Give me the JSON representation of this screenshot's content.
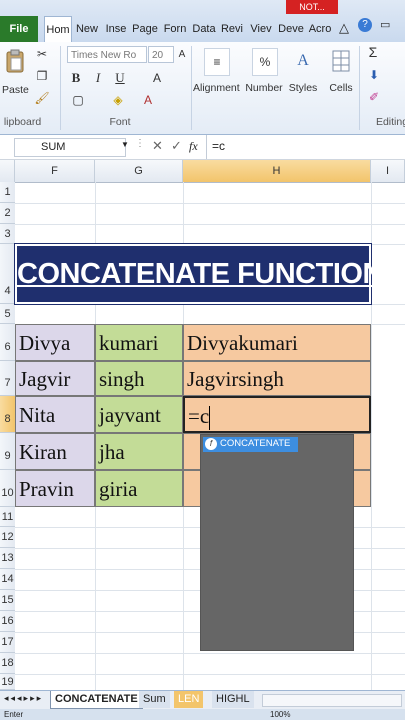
{
  "title_bar": {
    "alert_button": "NOT..."
  },
  "tabs": [
    {
      "label": "File"
    },
    {
      "label": "Hom"
    },
    {
      "label": "New"
    },
    {
      "label": "Inse"
    },
    {
      "label": "Page"
    },
    {
      "label": "Forn"
    },
    {
      "label": "Data"
    },
    {
      "label": "Revi"
    },
    {
      "label": "Viev"
    },
    {
      "label": "Deve"
    },
    {
      "label": "Acro"
    }
  ],
  "ribbon": {
    "paste": "Paste",
    "font_name": "Times New Ro",
    "font_size": "20",
    "bold": "B",
    "italic": "I",
    "underline": "U",
    "alignment": "Alignment",
    "number": "Number",
    "percent": "%",
    "styles": "Styles",
    "cells": "Cells",
    "editing": "Editing",
    "clipboard_label": "lipboard",
    "font_label": "Font",
    "sigma": "Σ"
  },
  "formula_bar": {
    "name_box": "SUM",
    "fx": "fx",
    "formula": "=c"
  },
  "columns": [
    "F",
    "G",
    "H",
    "I"
  ],
  "rows": [
    "1",
    "2",
    "3",
    "4",
    "5",
    "6",
    "7",
    "8",
    "9",
    "10",
    "11",
    "12",
    "13",
    "14",
    "15",
    "16",
    "17",
    "18",
    "19"
  ],
  "sheet": {
    "title": "CONCATENATE FUNCTION",
    "data": [
      {
        "first": "Divya",
        "last": "kumari",
        "result": "Divyakumari"
      },
      {
        "first": "Jagvir",
        "last": "singh",
        "result": "Jagvirsingh"
      },
      {
        "first": "Nita",
        "last": "jayvant",
        "result": "=c"
      },
      {
        "first": "Kiran",
        "last": "jha",
        "result": ""
      },
      {
        "first": "Pravin",
        "last": "giria",
        "result": ""
      }
    ]
  },
  "autocomplete": {
    "item": "CONCATENATE",
    "icon": "function-icon"
  },
  "sheet_tabs": [
    {
      "label": "CONCATENATE",
      "active": true
    },
    {
      "label": "Sum",
      "active": false
    },
    {
      "label": "LEN",
      "active": false
    },
    {
      "label": "HIGHL",
      "active": false
    }
  ],
  "status": {
    "mode": "Enter",
    "zoom": "100%"
  },
  "colors": {
    "title_bg": "#1f2f6e",
    "name_bg": "#dcd7ea",
    "last_bg": "#c3dc97",
    "result_bg": "#f6c9a0",
    "excel_green": "#2a7a2a"
  }
}
